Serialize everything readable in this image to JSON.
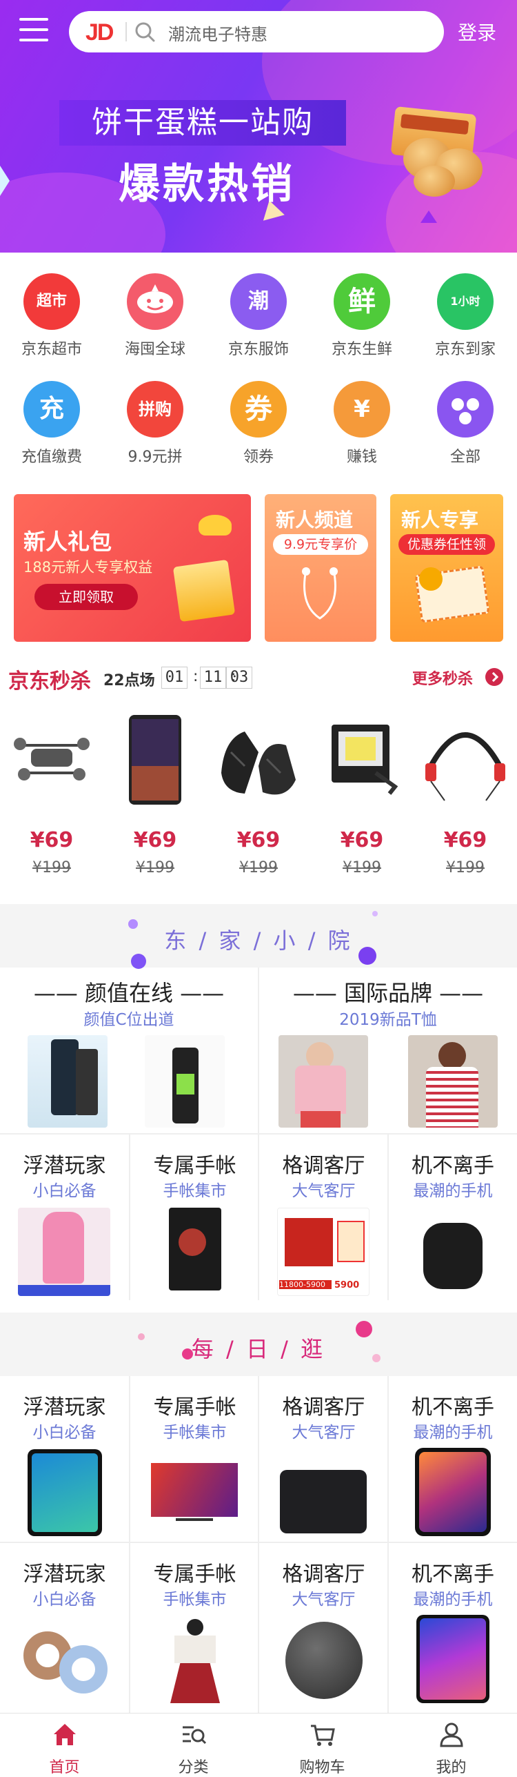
{
  "header": {
    "logo": "JD",
    "search_placeholder": "潮流电子特惠",
    "login": "登录"
  },
  "banner": {
    "title": "饼干蛋糕一站购",
    "subtitle": "爆款热销"
  },
  "nav": [
    {
      "label": "京东超市",
      "icon": "超市",
      "color": "#f23a3a"
    },
    {
      "label": "海囤全球",
      "icon": "",
      "color": "#f45b6b"
    },
    {
      "label": "京东服饰",
      "icon": "潮",
      "color": "#8b5cf0"
    },
    {
      "label": "京东生鲜",
      "icon": "鲜",
      "color": "#4fcb3a"
    },
    {
      "label": "京东到家",
      "icon": "1小时",
      "color": "#29c464"
    },
    {
      "label": "充值缴费",
      "icon": "充",
      "color": "#3aa3f0"
    },
    {
      "label": "9.9元拼",
      "icon": "拼购",
      "color": "#f2463c"
    },
    {
      "label": "领券",
      "icon": "券",
      "color": "#f7a32a"
    },
    {
      "label": "赚钱",
      "icon": "¥",
      "color": "#f59a3a"
    },
    {
      "label": "全部",
      "icon": "",
      "color": "#8a55f0"
    }
  ],
  "promos": {
    "p1": {
      "title": "新人礼包",
      "desc": "188元新人专享权益",
      "btn": "立即领取"
    },
    "p2": {
      "title": "新人频道",
      "pill": "9.9元专享价"
    },
    "p3": {
      "title": "新人专享",
      "pill": "优惠券任性领"
    }
  },
  "seckill": {
    "title": "京东秒杀",
    "slot": "22点场",
    "h": "01",
    "m": "11",
    "s": "03",
    "more": "更多秒杀",
    "items": [
      {
        "price": "¥69",
        "old": "¥199",
        "icon": "drone-icon"
      },
      {
        "price": "¥69",
        "old": "¥199",
        "icon": "phone-icon"
      },
      {
        "price": "¥69",
        "old": "¥199",
        "icon": "sneakers-icon"
      },
      {
        "price": "¥69",
        "old": "¥199",
        "icon": "floodlight-icon"
      },
      {
        "price": "¥69",
        "old": "¥199",
        "icon": "earphones-icon"
      }
    ]
  },
  "courtyard": {
    "title": "东 / 家 / 小 / 院",
    "left": {
      "title": "—— 颜值在线 ——",
      "sub": "颜值C位出道"
    },
    "right": {
      "title": "—— 国际品牌 ——",
      "sub": "2019新品T恤"
    },
    "cells": [
      {
        "title": "浮潜玩家",
        "sub": "小白必备"
      },
      {
        "title": "专属手帐",
        "sub": "手帐集市"
      },
      {
        "title": "格调客厅",
        "sub": "大气客厅"
      },
      {
        "title": "机不离手",
        "sub": "最潮的手机"
      }
    ],
    "promo_text": "11800-5900",
    "promo_text2": "5900"
  },
  "daily": {
    "title": "每 / 日 / 逛",
    "row1": [
      {
        "title": "浮潜玩家",
        "sub": "小白必备"
      },
      {
        "title": "专属手帐",
        "sub": "手帐集市"
      },
      {
        "title": "格调客厅",
        "sub": "大气客厅"
      },
      {
        "title": "机不离手",
        "sub": "最潮的手机"
      }
    ],
    "row2": [
      {
        "title": "浮潜玩家",
        "sub": "小白必备"
      },
      {
        "title": "专属手帐",
        "sub": "手帐集市"
      },
      {
        "title": "格调客厅",
        "sub": "大气客厅"
      },
      {
        "title": "机不离手",
        "sub": "最潮的手机"
      }
    ]
  },
  "tabbar": [
    {
      "label": "首页",
      "active": true
    },
    {
      "label": "分类",
      "active": false
    },
    {
      "label": "购物车",
      "active": false
    },
    {
      "label": "我的",
      "active": false
    }
  ],
  "colors": {
    "accent": "#d0284a",
    "sub": "#6b79d6"
  }
}
